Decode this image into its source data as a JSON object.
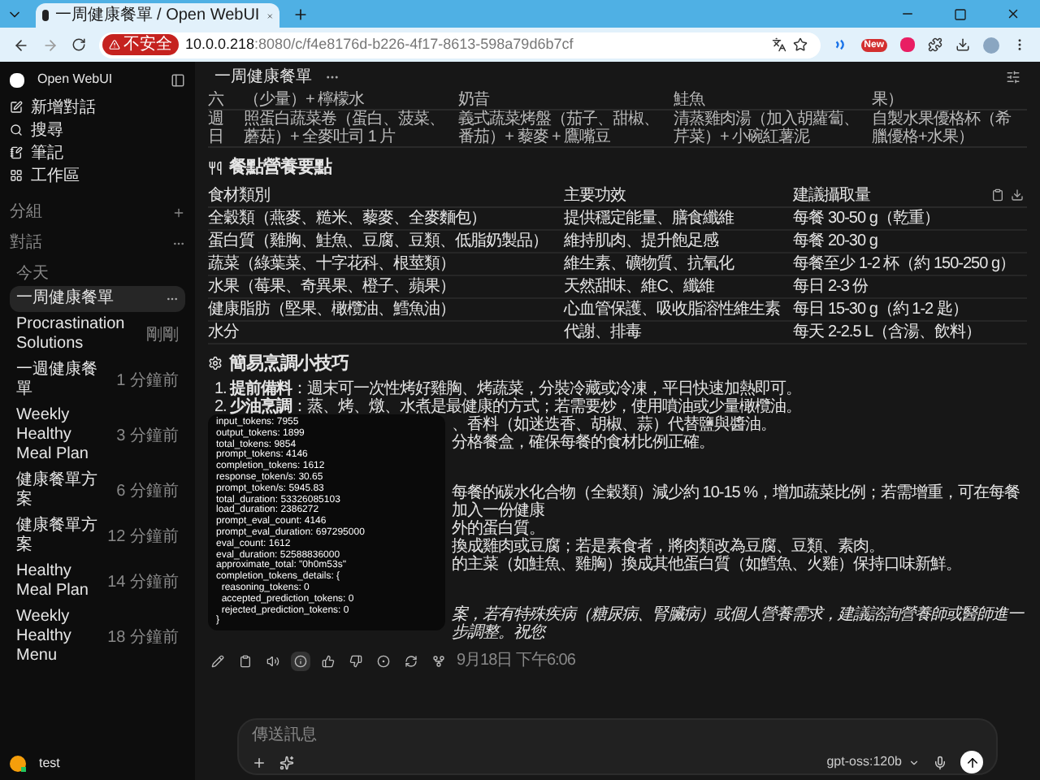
{
  "browser": {
    "tab_title": "一周健康餐單 / Open WebUI",
    "security_label": "不安全",
    "url_host": "10.0.0.218",
    "url_rest": ":8080/c/f4e8176d-b226-4f17-8613-598a79d6b7cf",
    "extension_badge": "New"
  },
  "sidebar": {
    "app_name": "Open WebUI",
    "nav": [
      {
        "kind": "new",
        "label": "新增對話"
      },
      {
        "kind": "search",
        "label": "搜尋"
      },
      {
        "kind": "notes",
        "label": "筆記"
      },
      {
        "kind": "workspace",
        "label": "工作區"
      }
    ],
    "groups_label": "分組",
    "chats_label": "對話",
    "date_label": "今天",
    "chats": [
      {
        "title": "一周健康餐單",
        "selected": true
      },
      {
        "title": "Procrastination Solutions",
        "time": "剛剛",
        "selected": false
      },
      {
        "title": "一週健康餐單",
        "time": "1 分鐘前",
        "selected": false
      },
      {
        "title": "Weekly Healthy Meal Plan",
        "time": "3 分鐘前",
        "selected": false
      },
      {
        "title": "健康餐單方案",
        "time": "6 分鐘前",
        "selected": false
      },
      {
        "title": "健康餐單方案",
        "time": "12 分鐘前",
        "selected": false
      },
      {
        "title": "Healthy Meal Plan",
        "time": "14 分鐘前",
        "selected": false
      },
      {
        "title": "Weekly Healthy Menu",
        "time": "18 分鐘前",
        "selected": false
      }
    ],
    "user": "test"
  },
  "chat": {
    "title": "一周健康餐單"
  },
  "meal_table": {
    "rows": [
      [
        "六",
        "（少量）+ 檸檬水",
        "奶昔",
        "鮭魚",
        "果）"
      ],
      [
        "週日",
        "照蛋白蔬菜卷（蛋白、菠菜、蘑菇）+ 全麥吐司 1 片",
        "義式蔬菜烤盤（茄子、甜椒、番茄）+ 藜麥 + 鷹嘴豆",
        "清蒸雞肉湯（加入胡蘿蔔、芹菜）+ 小碗紅薯泥",
        "自製水果優格杯（希臘優格+水果）"
      ]
    ]
  },
  "nutrition": {
    "heading": "餐點營養要點",
    "columns": [
      "食材類別",
      "主要功效",
      "建議攝取量"
    ],
    "rows": [
      [
        "全穀類（燕麥、糙米、藜麥、全麥麵包）",
        "提供穩定能量、膳食纖維",
        "每餐 30-50 g（乾重）"
      ],
      [
        "蛋白質（雞胸、鮭魚、豆腐、豆類、低脂奶製品）",
        "維持肌肉、提升飽足感",
        "每餐 20-30 g"
      ],
      [
        "蔬菜（綠葉菜、十字花科、根莖類）",
        "維生素、礦物質、抗氧化",
        "每餐至少 1-2 杯（約 150-250 g）"
      ],
      [
        "水果（莓果、奇異果、橙子、蘋果）",
        "天然甜味、維C、纖維",
        "每日 2-3 份"
      ],
      [
        "健康脂肪（堅果、橄欖油、鱈魚油）",
        "心血管保護、吸收脂溶性維生素",
        "每日 15-30 g（約 1-2 匙）"
      ],
      [
        "水分",
        "代謝、排毒",
        "每天 2-2.5 L（含湯、飲料）"
      ]
    ]
  },
  "tips": {
    "heading": "簡易烹調小技巧",
    "lines": [
      {
        "kind": "numbered",
        "number": "1.",
        "text": "**提前備料**：週末可一次性烤好雞胸、烤蔬菜，分裝冷藏或冷凍，平日快速加熱即可。"
      },
      {
        "kind": "numbered",
        "number": "2.",
        "text": "**少油烹調**：蒸、烤、燉、水煮是最健康的方式；若需要炒，使用噴油或少量橄欖油。"
      },
      {
        "kind": "fragment",
        "text": "、香料（如迷迭香、胡椒、蒜）代替鹽與醬油。"
      },
      {
        "kind": "fragment",
        "text": "分格餐盒，確保每餐的食材比例正確。"
      },
      {
        "kind": "gap"
      },
      {
        "kind": "fragment",
        "text": "每餐的碳水化合物（全穀類）減少約 10-15 %，增加蔬菜比例；若需增重，可在每餐加入一份健康"
      },
      {
        "kind": "fragment",
        "text": "外的蛋白質。"
      },
      {
        "kind": "fragment",
        "text": "換成雞肉或豆腐；若是素食者，將肉類改為豆腐、豆類、素肉。"
      },
      {
        "kind": "fragment",
        "text": "的主菜（如鮭魚、雞胸）換成其他蛋白質（如鱈魚、火雞）保持口味新鮮。"
      },
      {
        "kind": "gap"
      },
      {
        "kind": "italic",
        "text": "案，若有特殊疾病（糖尿病、腎臟病）或個人營養需求，建議諮詢營養師或醫師進一步調整。祝您"
      }
    ]
  },
  "token_popup": {
    "lines": [
      "input_tokens: 7955",
      "output_tokens: 1899",
      "total_tokens: 9854",
      "prompt_tokens: 4146",
      "completion_tokens: 1612",
      "response_token/s: 30.65",
      "prompt_token/s: 5945.83",
      "total_duration: 53326085103",
      "load_duration: 2386272",
      "prompt_eval_count: 4146",
      "prompt_eval_duration: 697295000",
      "eval_count: 1612",
      "eval_duration: 52588836000",
      "approximate_total: \"0h0m53s\"",
      "completion_tokens_details: {",
      "  reasoning_tokens: 0",
      "  accepted_prediction_tokens: 0",
      "  rejected_prediction_tokens: 0",
      "}"
    ]
  },
  "message_actions": [
    {
      "kind": "edit",
      "highlighted": false
    },
    {
      "kind": "copy",
      "highlighted": false
    },
    {
      "kind": "speak",
      "highlighted": false
    },
    {
      "kind": "info",
      "highlighted": true
    },
    {
      "kind": "like",
      "highlighted": false
    },
    {
      "kind": "dislike",
      "highlighted": false
    },
    {
      "kind": "continue",
      "highlighted": false
    },
    {
      "kind": "regenerate",
      "highlighted": false
    },
    {
      "kind": "share",
      "highlighted": false
    }
  ],
  "timestamp": "9月18日 下午6:06",
  "composer": {
    "placeholder": "傳送訊息",
    "model": "gpt-oss:120b"
  }
}
